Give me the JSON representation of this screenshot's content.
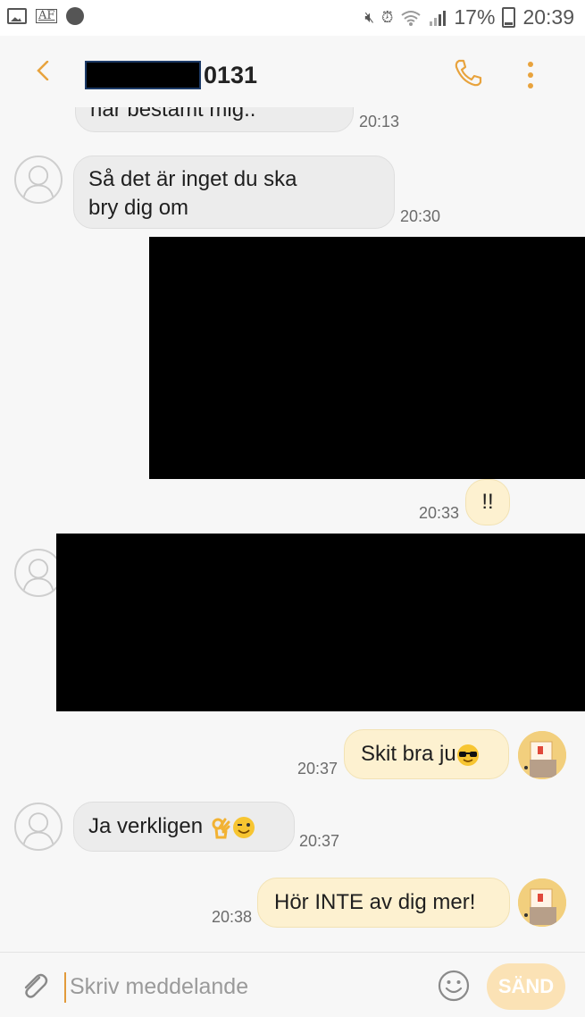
{
  "status_bar": {
    "icons": [
      "picture-icon",
      "af-icon",
      "whatsapp-icon",
      "mute-icon",
      "alarm-icon",
      "wifi-icon",
      "signal-icon",
      "battery-icon"
    ],
    "af_label": "AF",
    "battery": "17%",
    "time": "20:39"
  },
  "header": {
    "contact_suffix": "0131",
    "icons": [
      "back-icon",
      "phone-icon",
      "more-icon"
    ]
  },
  "messages": [
    {
      "direction": "in",
      "text": "har bestämt mig..",
      "time": "20:13"
    },
    {
      "direction": "in",
      "text_line1": "Så det är inget du ska",
      "text_line2": "bry dig om",
      "time": "20:30"
    },
    {
      "direction": "out",
      "redacted": true
    },
    {
      "direction": "out",
      "text": "!!",
      "time": "20:33"
    },
    {
      "direction": "in",
      "redacted": true
    },
    {
      "direction": "out",
      "text": "Skit bra ju",
      "emoji": "sunglasses-emoji",
      "time": "20:37"
    },
    {
      "direction": "in",
      "text": "Ja verkligen",
      "emoji": "ok-hand-wink-emoji",
      "time": "20:37"
    },
    {
      "direction": "out",
      "text": "Hör INTE av dig mer!",
      "time": "20:38"
    }
  ],
  "input": {
    "placeholder": "Skriv meddelande",
    "value": "",
    "send_label": "SÄND",
    "icons": [
      "attach-icon",
      "smiley-icon"
    ]
  },
  "colors": {
    "accent": "#e8a33d",
    "incoming_bubble": "#ececec",
    "outgoing_bubble": "#fdf1d0",
    "send_button": "#fbe2b5"
  }
}
